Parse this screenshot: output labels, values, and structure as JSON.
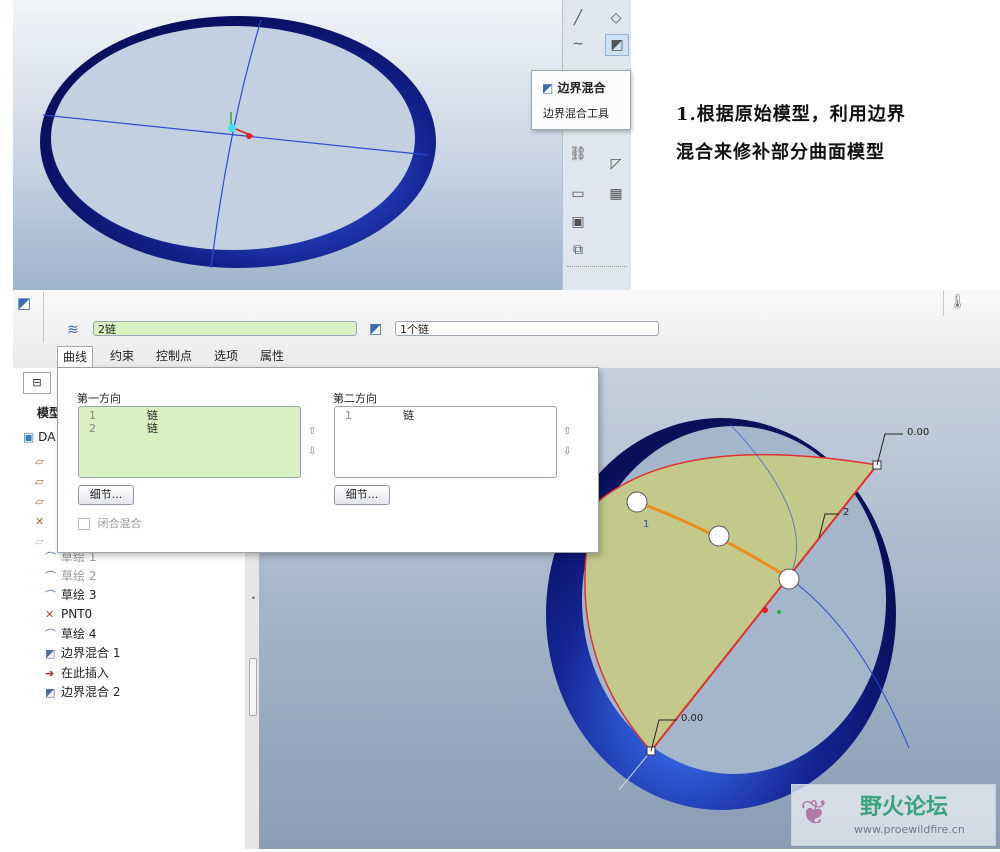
{
  "tooltip": {
    "title": "边界混合",
    "subtitle": "边界混合工具"
  },
  "instruction": {
    "line1": "1.根据原始模型，利用边界",
    "line2": "混合来修补部分曲面模型"
  },
  "dashboard": {
    "first_collector": "2链",
    "second_collector": "1个链",
    "tabs": [
      "曲线",
      "约束",
      "控制点",
      "选项",
      "属性"
    ]
  },
  "curves_panel": {
    "first_direction": {
      "label": "第一方向",
      "rows": [
        {
          "n": "1",
          "v": "链"
        },
        {
          "n": "2",
          "v": "链"
        }
      ],
      "details_button": "细节..."
    },
    "second_direction": {
      "label": "第二方向",
      "rows": [
        {
          "n": "1",
          "v": "链"
        }
      ],
      "details_button": "细节..."
    },
    "closed_blend": "闭合混合"
  },
  "model_tree": {
    "header": "模型",
    "root": "DA",
    "items": [
      {
        "label": "草绘 1",
        "dim": true
      },
      {
        "label": "草绘 2",
        "dim": true
      },
      {
        "label": "草绘 3",
        "dim": false
      },
      {
        "label": "PNT0",
        "dim": false
      },
      {
        "label": "草绘 4",
        "dim": false
      },
      {
        "label": "边界混合 1",
        "dim": false
      },
      {
        "label": "在此插入",
        "dim": false
      },
      {
        "label": "边界混合 2",
        "dim": false
      }
    ]
  },
  "annotations": {
    "value_top": "0.00",
    "value_bottom": "0.00",
    "index_left": "1",
    "index_right": "2"
  },
  "watermark": {
    "name": "野火论坛",
    "url": "www.proewildfire.cn"
  },
  "colors": {
    "accent_green": "#d9f0c0",
    "surface": "#c3c98a",
    "ring": "#1c2c8c",
    "edge_red": "#e03030",
    "edge_orange": "#f08c1c"
  }
}
